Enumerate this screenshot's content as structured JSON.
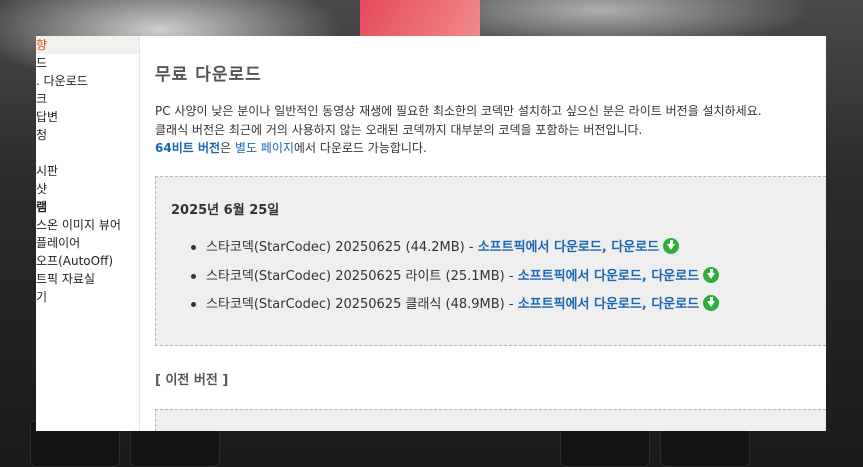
{
  "sidebar": {
    "items": [
      "향",
      "드",
      ". 다운로드",
      "크",
      "답변",
      "청",
      "",
      "시판",
      "샷",
      "램",
      "스온 이미지 뷰어",
      "플레이어",
      "오프(AutoOff)",
      "트픽 자료실",
      "기"
    ]
  },
  "main": {
    "title": "무료 다운로드",
    "desc_line1": "PC 사양이 낮은 분이나 일반적인 동영상 재생에 필요한 최소한의 코덱만 설치하고 싶으신 분은 라이트 버전을 설치하세요.",
    "desc_line2": "클래식 버전은 최근에 거의 사용하지 않는 오래된 코덱까지 대부분의 코덱을 포함하는 버전입니다.",
    "desc_line3_link1": "64비트 버전",
    "desc_line3_text1": "은 ",
    "desc_line3_link2": "별도 페이지",
    "desc_line3_text2": "에서 다운로드 가능합니다.",
    "release_date": "2025년 6월 25일",
    "downloads": [
      {
        "name": "스타코덱(StarCodec) 20250625 (44.2MB)",
        "sep": " - ",
        "link1": "소프트픽에서 다운로드",
        "comma": ", ",
        "link2": "다운로드"
      },
      {
        "name": "스타코덱(StarCodec) 20250625 라이트 (25.1MB)",
        "sep": " - ",
        "link1": "소프트픽에서 다운로드",
        "comma": ", ",
        "link2": "다운로드"
      },
      {
        "name": "스타코덱(StarCodec) 20250625 클래식 (48.9MB)",
        "sep": " - ",
        "link1": "소프트픽에서 다운로드",
        "comma": ", ",
        "link2": "다운로드"
      }
    ],
    "previous_heading": "[ 이전 버전 ]"
  },
  "icons": {
    "download": "download-arrow-icon"
  },
  "colors": {
    "link": "#1a66b3",
    "active_sidebar": "#d9531e",
    "download_icon": "#2eae3a",
    "box_bg": "#efefef"
  }
}
